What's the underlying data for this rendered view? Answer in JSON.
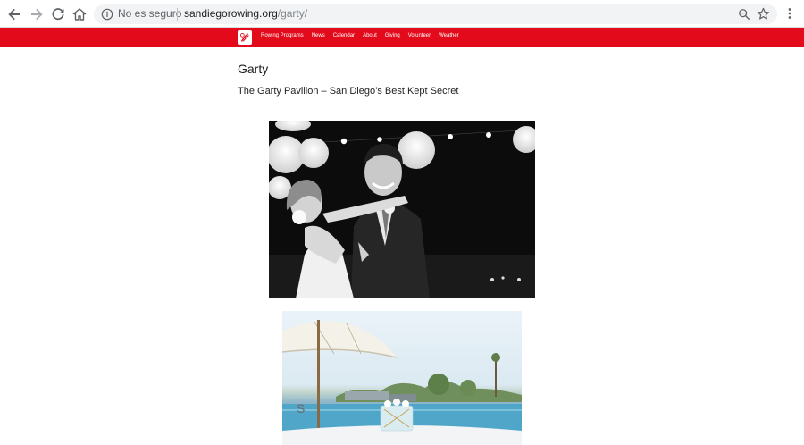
{
  "browser": {
    "security_label": "No es seguro",
    "url_host": "sandiegorowing.org",
    "url_path": "/garty/"
  },
  "site_nav": {
    "links": [
      "Rowing Programs",
      "News",
      "Calendar",
      "About",
      "Giving",
      "Volunteer",
      "Weather"
    ]
  },
  "page": {
    "title": "Garty",
    "subtitle": "The Garty Pavilion – San Diego’s Best Kept Secret"
  },
  "photos": {
    "sign_letter": "S"
  },
  "colors": {
    "site_nav_bg": "#e30b1b",
    "omnibox_bg": "#f1f3f4"
  },
  "icons": [
    "back-arrow-icon",
    "forward-arrow-icon",
    "reload-icon",
    "home-icon",
    "info-icon",
    "zoom-icon",
    "star-icon",
    "more-vert-icon",
    "site-logo"
  ]
}
